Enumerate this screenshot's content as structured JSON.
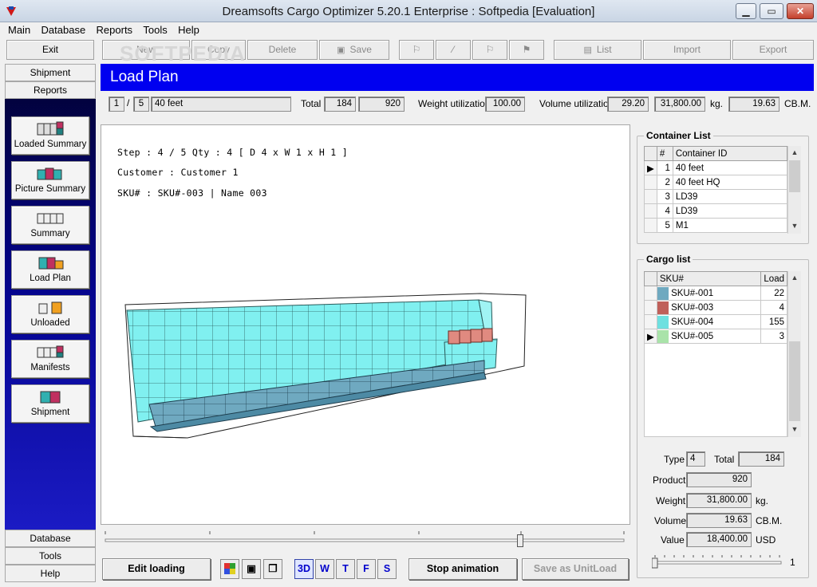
{
  "window": {
    "title": "Dreamsofts Cargo Optimizer 5.20.1 Enterprise : Softpedia [Evaluation]",
    "controls": {
      "minimize": "▁",
      "maximize": "▭",
      "close": "✕"
    }
  },
  "menu": [
    "Main",
    "Database",
    "Reports",
    "Tools",
    "Help"
  ],
  "toolbar": {
    "exit": "Exit",
    "new": "New",
    "copy": "Copy",
    "delete": "Delete",
    "save": "Save",
    "list": "List",
    "import": "Import",
    "export": "Export"
  },
  "watermark": "SOFTPEDIA",
  "sidebar": {
    "tab_top_1": "Shipment",
    "tab_top_2": "Reports",
    "buttons": [
      "Loaded Summary",
      "Picture Summary",
      "Summary",
      "Load Plan",
      "Unloaded",
      "Manifests",
      "Shipment"
    ],
    "tab_bottom_1": "Database",
    "tab_bottom_2": "Tools",
    "tab_bottom_3": "Help"
  },
  "banner": {
    "title": "Load Plan"
  },
  "info": {
    "index": "1",
    "sep": "/",
    "count": "5",
    "container": "40 feet",
    "total_label": "Total",
    "total_1": "184",
    "total_2": "920",
    "weight_label": "Weight utilization",
    "weight_value": "100.00",
    "volume_label": "Volume utilization",
    "volume_value": "29.20",
    "weight_kg": "31,800.00",
    "kg_unit": "kg.",
    "cbm_value": "19.63",
    "cbm_unit": "CB.M."
  },
  "canvas": {
    "step_line": "Step : 4 / 5  Qty :  4  [ D 4 x W 1 x H 1 ]",
    "customer_line": "Customer : Customer 1",
    "sku_line": "SKU# : SKU#-003 | Name 003"
  },
  "container_list": {
    "title": "Container List",
    "headers": [
      "#",
      "Container ID"
    ],
    "rows": [
      {
        "num": "1",
        "id": "40 feet"
      },
      {
        "num": "2",
        "id": "40 feet HQ"
      },
      {
        "num": "3",
        "id": "LD39"
      },
      {
        "num": "4",
        "id": "LD39"
      },
      {
        "num": "5",
        "id": "M1"
      }
    ]
  },
  "cargo_list": {
    "title": "Cargo list",
    "headers": [
      "SKU#",
      "Load"
    ],
    "rows": [
      {
        "sku": "SKU#-001",
        "load": "22",
        "color": "#6fa9c0"
      },
      {
        "sku": "SKU#-003",
        "load": "4",
        "color": "#c0605a"
      },
      {
        "sku": "SKU#-004",
        "load": "155",
        "color": "#6fe0e0"
      },
      {
        "sku": "SKU#-005",
        "load": "3",
        "color": "#a9e3a9"
      }
    ]
  },
  "summary": {
    "type_label": "Type",
    "type_value": "4",
    "total_label": "Total",
    "total_value": "184",
    "product_label": "Product",
    "product_value": "920",
    "weight_label": "Weight",
    "weight_value": "31,800.00",
    "weight_unit": "kg.",
    "volume_label": "Volume",
    "volume_value": "19.63",
    "volume_unit": "CB.M.",
    "value_label": "Value",
    "value_value": "18,400.00",
    "value_unit": "USD",
    "slider_value": "1"
  },
  "bottom": {
    "edit": "Edit loading",
    "views": [
      "3D",
      "W",
      "T",
      "F",
      "S"
    ],
    "stop": "Stop animation",
    "save_unit": "Save as UnitLoad"
  },
  "colors": {
    "banner": "#0000f0",
    "box_cyan": "#80f0f0",
    "box_steel": "#6fa9c0",
    "box_red": "#e08a80"
  }
}
